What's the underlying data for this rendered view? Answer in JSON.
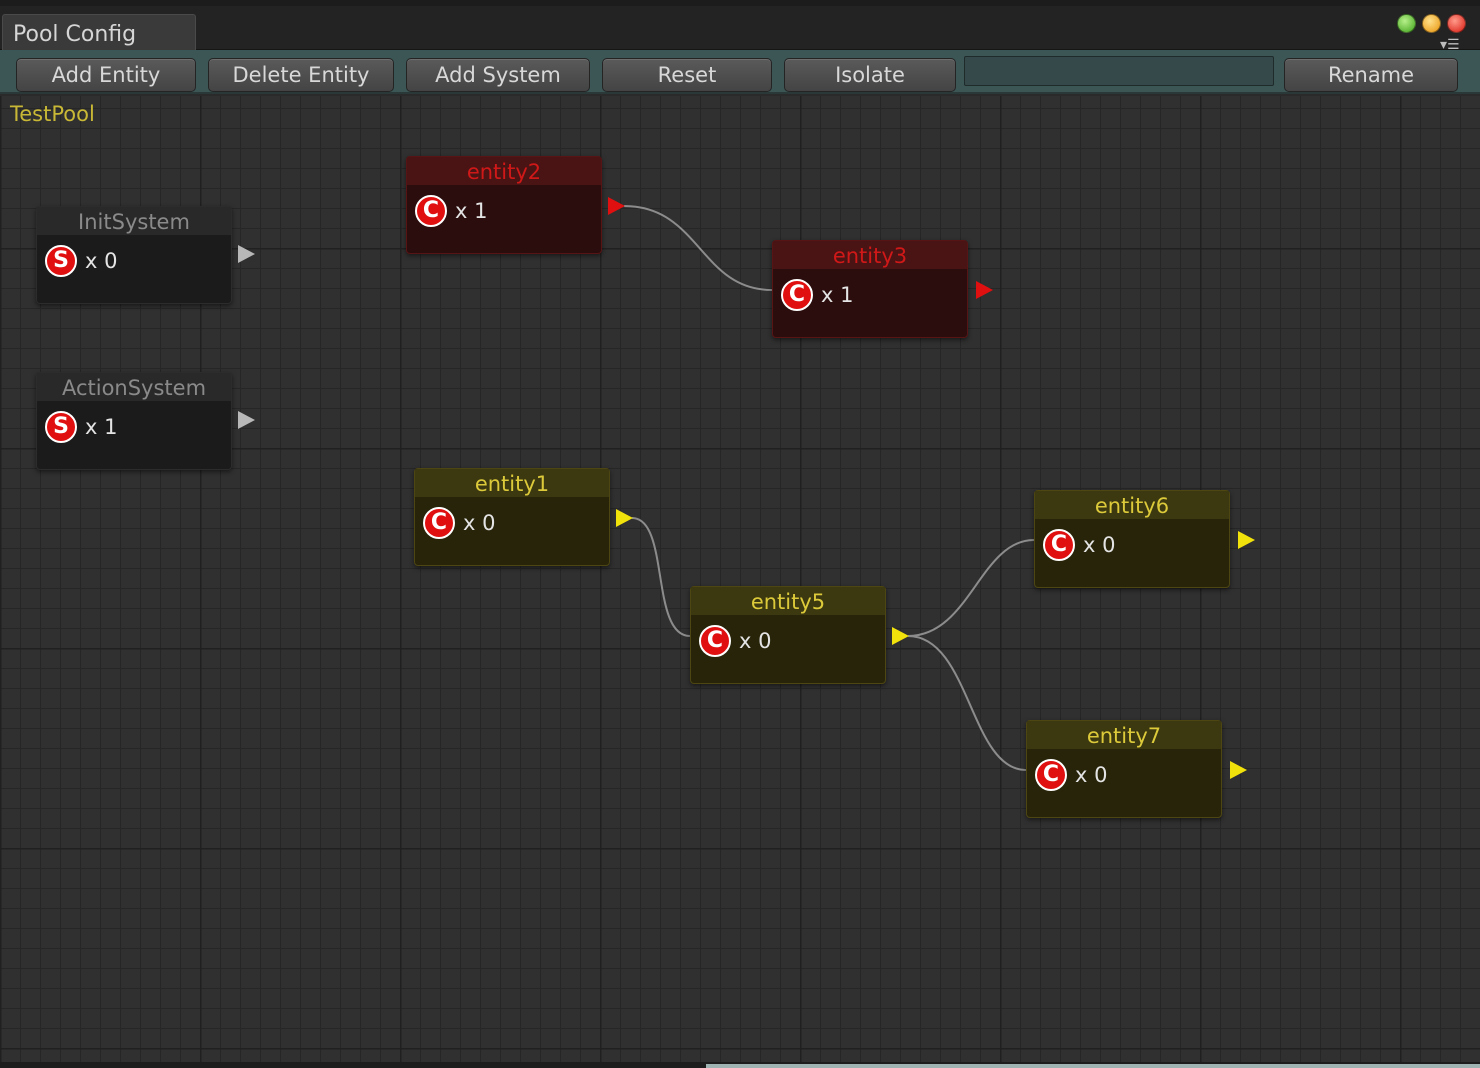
{
  "window": {
    "tab_title": "Pool Config",
    "controls": [
      "green",
      "yellow",
      "red"
    ]
  },
  "toolbar": {
    "add_entity": "Add Entity",
    "delete_entity": "Delete Entity",
    "add_system": "Add System",
    "reset": "Reset",
    "isolate": "Isolate",
    "name_field_value": "",
    "rename": "Rename"
  },
  "pool": {
    "name": "TestPool"
  },
  "nodes": {
    "init_system": {
      "title": "InitSystem",
      "icon": "S",
      "count": "x 0",
      "kind": "system"
    },
    "action_system": {
      "title": "ActionSystem",
      "icon": "S",
      "count": "x 1",
      "kind": "system"
    },
    "entity2": {
      "title": "entity2",
      "icon": "C",
      "count": "x 1",
      "kind": "selected"
    },
    "entity3": {
      "title": "entity3",
      "icon": "C",
      "count": "x 1",
      "kind": "selected"
    },
    "entity1": {
      "title": "entity1",
      "icon": "C",
      "count": "x 0",
      "kind": "entity"
    },
    "entity5": {
      "title": "entity5",
      "icon": "C",
      "count": "x 0",
      "kind": "entity"
    },
    "entity6": {
      "title": "entity6",
      "icon": "C",
      "count": "x 0",
      "kind": "entity"
    },
    "entity7": {
      "title": "entity7",
      "icon": "C",
      "count": "x 0",
      "kind": "entity"
    }
  },
  "connections": [
    {
      "from": "entity2",
      "to": "entity3"
    },
    {
      "from": "entity1",
      "to": "entity5"
    },
    {
      "from": "entity5",
      "to": "entity6"
    },
    {
      "from": "entity5",
      "to": "entity7"
    }
  ],
  "colors": {
    "selected_title": "#d01818",
    "entity_title": "#dcca3a",
    "port_selected": "#e01010",
    "port_entity": "#f2e20c",
    "port_system": "#b8b8b8",
    "link": "#8c8c8c",
    "badge": "#e01010",
    "toolbar": "#3c5555",
    "pool_label": "#c9b836"
  }
}
